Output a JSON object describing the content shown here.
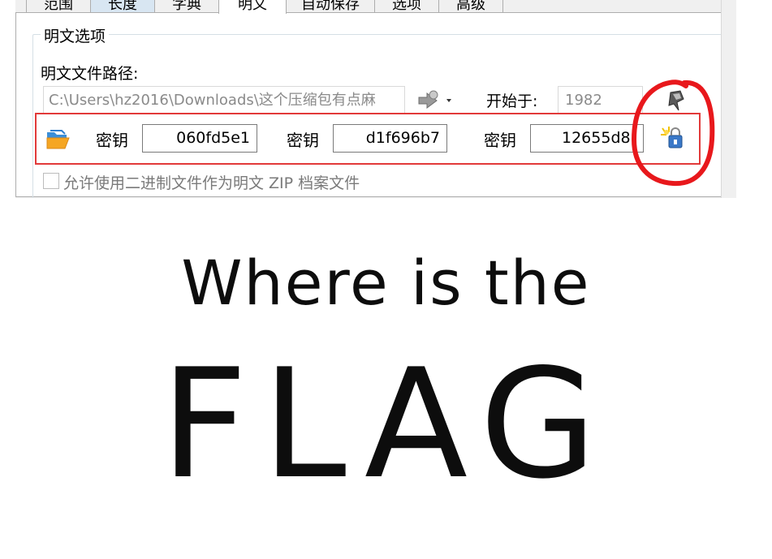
{
  "tabs": [
    {
      "label": "范围",
      "state": "normal"
    },
    {
      "label": "长度",
      "state": "hover"
    },
    {
      "label": "字典",
      "state": "normal"
    },
    {
      "label": "明文",
      "state": "active"
    },
    {
      "label": "自动保存",
      "state": "normal"
    },
    {
      "label": "选项",
      "state": "normal"
    },
    {
      "label": "高级",
      "state": "normal"
    }
  ],
  "plaintext_options": {
    "group_title": "明文选项",
    "path_label": "明文文件路径:",
    "path_value": "C:\\Users\\hz2016\\Downloads\\这个压缩包有点麻",
    "start_label": "开始于:",
    "start_value": "1982",
    "keys": [
      {
        "label": "密钥",
        "value": "060fd5e1"
      },
      {
        "label": "密钥",
        "value": "d1f696b7"
      },
      {
        "label": "密钥",
        "value": "12655d8"
      }
    ],
    "allow_binary_label": "允许使用二进制文件作为明文 ZIP 档案文件",
    "allow_binary_checked": false
  },
  "annotation": {
    "rect_color": "#e23a3a",
    "circle_color": "#e8181c"
  },
  "caption": {
    "line1": "Where is the",
    "line2": "FLAG"
  },
  "icons": {
    "folder": "folder-open-icon",
    "browse": "browse-dropdown-icon",
    "pin": "pin-icon",
    "lock": "lock-key-icon"
  }
}
